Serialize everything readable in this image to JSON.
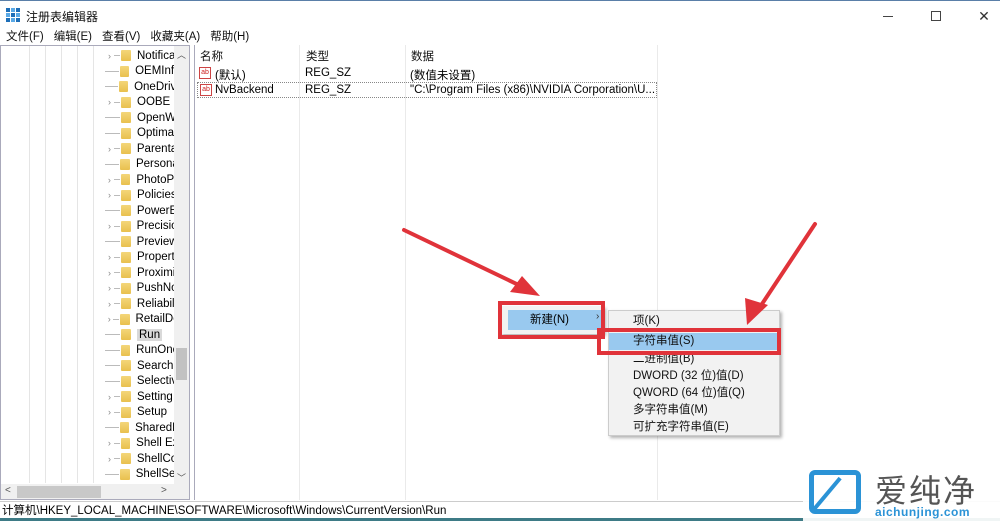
{
  "window": {
    "title": "注册表编辑器",
    "controls": {
      "minimize": "—",
      "maximize": "☐",
      "close": "✕"
    }
  },
  "menubar": [
    "文件(F)",
    "编辑(E)",
    "查看(V)",
    "收藏夹(A)",
    "帮助(H)"
  ],
  "tree": {
    "items": [
      {
        "label": "Notifica",
        "expandable": true
      },
      {
        "label": "OEMInfo",
        "expandable": false
      },
      {
        "label": "OneDrive",
        "expandable": false
      },
      {
        "label": "OOBE",
        "expandable": true
      },
      {
        "label": "OpenW",
        "expandable": false
      },
      {
        "label": "Optimal",
        "expandable": false
      },
      {
        "label": "Parenta",
        "expandable": true
      },
      {
        "label": "Persona",
        "expandable": false
      },
      {
        "label": "PhotoPr",
        "expandable": true
      },
      {
        "label": "Policies",
        "expandable": true
      },
      {
        "label": "PowerE",
        "expandable": false
      },
      {
        "label": "Precisio",
        "expandable": true
      },
      {
        "label": "Preview",
        "expandable": false
      },
      {
        "label": "Propert",
        "expandable": true
      },
      {
        "label": "Proximi",
        "expandable": true
      },
      {
        "label": "PushNo",
        "expandable": true
      },
      {
        "label": "Reliabili",
        "expandable": true
      },
      {
        "label": "RetailDe",
        "expandable": true
      },
      {
        "label": "Run",
        "expandable": false,
        "selected": true
      },
      {
        "label": "RunOnc",
        "expandable": false
      },
      {
        "label": "Search",
        "expandable": false
      },
      {
        "label": "Selectiv",
        "expandable": false
      },
      {
        "label": "Setting",
        "expandable": true
      },
      {
        "label": "Setup",
        "expandable": true
      },
      {
        "label": "SharedD",
        "expandable": false
      },
      {
        "label": "Shell Ex",
        "expandable": true
      },
      {
        "label": "ShellCo",
        "expandable": true
      },
      {
        "label": "ShellSer",
        "expandable": false
      }
    ]
  },
  "list": {
    "columns": [
      "名称",
      "类型",
      "数据"
    ],
    "rows": [
      {
        "name": "(默认)",
        "type": "REG_SZ",
        "data": "(数值未设置)",
        "icon": "ab"
      },
      {
        "name": "NvBackend",
        "type": "REG_SZ",
        "data": "\"C:\\Program Files (x86)\\NVIDIA Corporation\\U...",
        "icon": "ab"
      }
    ]
  },
  "context_menu": {
    "new_label": "新建(N)",
    "submenu": [
      "项(K)",
      "字符串值(S)",
      "二进制值(B)",
      "DWORD (32 位)值(D)",
      "QWORD (64 位)值(Q)",
      "多字符串值(M)",
      "可扩充字符串值(E)"
    ],
    "highlighted_index": 1
  },
  "statusbar": {
    "path": "计算机\\HKEY_LOCAL_MACHINE\\SOFTWARE\\Microsoft\\Windows\\CurrentVersion\\Run"
  },
  "watermark": {
    "cn": "爱纯净",
    "url": "aichunjing.com"
  },
  "colors": {
    "highlight": "#99c9ef",
    "annotation_red": "#e0333a",
    "watermark_blue": "#2b93d6"
  }
}
